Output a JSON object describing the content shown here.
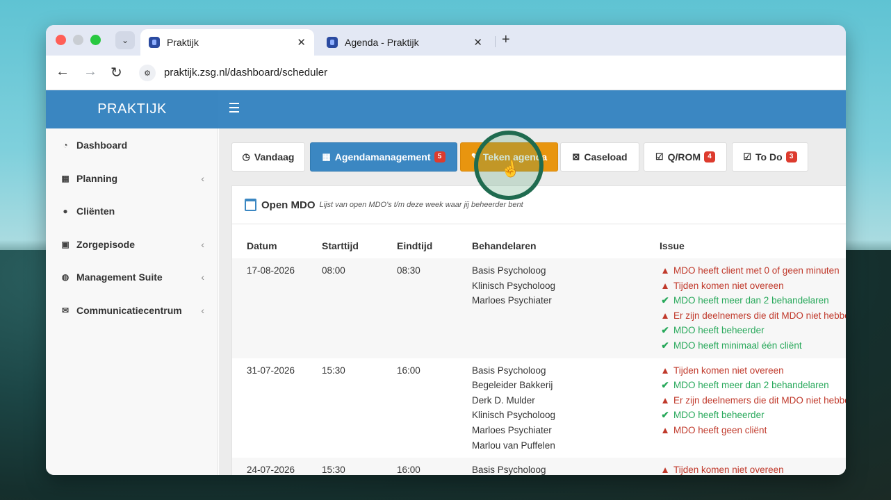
{
  "browser": {
    "tabs": [
      {
        "title": "Praktijk",
        "close": "✕"
      },
      {
        "title": "Agenda - Praktijk",
        "close": "✕"
      }
    ],
    "new_tab": "+",
    "url": "praktijk.zsg.nl/dashboard/scheduler",
    "back": "←",
    "forward": "→",
    "reload": "↻"
  },
  "app": {
    "brand": "PRAKTIJK"
  },
  "sidebar": {
    "items": [
      {
        "label": "Dashboard",
        "icon": "dashboard-icon",
        "glyph": "◔"
      },
      {
        "label": "Planning",
        "icon": "calendar-icon",
        "glyph": "▦",
        "chevron": "‹"
      },
      {
        "label": "Cliënten",
        "icon": "user-icon",
        "glyph": "●"
      },
      {
        "label": "Zorgepisode",
        "icon": "medkit-icon",
        "glyph": "▣",
        "chevron": "‹"
      },
      {
        "label": "Management Suite",
        "icon": "globe-icon",
        "glyph": "◍",
        "chevron": "‹"
      },
      {
        "label": "Communicatiecentrum",
        "icon": "envelope-icon",
        "glyph": "✉",
        "chevron": "‹"
      }
    ]
  },
  "toolbar": {
    "buttons": [
      {
        "label": "Vandaag",
        "icon": "clock-icon",
        "glyph": "◷"
      },
      {
        "label": "Agendamanagement",
        "icon": "calendar-icon",
        "glyph": "▦",
        "badge": "5"
      },
      {
        "label": "Teken agenda",
        "icon": "pencil-icon",
        "glyph": "✎"
      },
      {
        "label": "Caseload",
        "icon": "caseload-icon",
        "glyph": "⊠"
      },
      {
        "label": "Q/ROM",
        "icon": "checkbox-icon",
        "glyph": "☑",
        "badge": "4"
      },
      {
        "label": "To Do",
        "icon": "checkbox-icon",
        "glyph": "☑",
        "badge": "3"
      }
    ]
  },
  "panel": {
    "title": "Open MDO",
    "subtitle": "Lijst van open MDO's t/m deze week waar jij beheerder bent",
    "columns": [
      "Datum",
      "Starttijd",
      "Eindtijd",
      "Behandelaren",
      "Issue"
    ],
    "rows": [
      {
        "date": "17-08-2026",
        "start": "08:00",
        "end": "08:30",
        "behandelaren": [
          "Basis Psycholoog",
          "Klinisch Psycholoog",
          "Marloes Psychiater"
        ],
        "issues": [
          {
            "text": "MDO heeft client met 0 of geen minuten",
            "status": "bad"
          },
          {
            "text": "Tijden komen niet overeen",
            "status": "bad"
          },
          {
            "text": "MDO heeft meer dan 2 behandelaren",
            "status": "good"
          },
          {
            "text": "Er zijn deelnemers die dit MDO niet hebben",
            "status": "bad"
          },
          {
            "text": "MDO heeft beheerder",
            "status": "good"
          },
          {
            "text": "MDO heeft minimaal één cliënt",
            "status": "good"
          }
        ]
      },
      {
        "date": "31-07-2026",
        "start": "15:30",
        "end": "16:00",
        "behandelaren": [
          "Basis Psycholoog",
          "Begeleider Bakkerij",
          "Derk D. Mulder",
          "Klinisch Psycholoog",
          "Marloes Psychiater",
          "Marlou van Puffelen"
        ],
        "issues": [
          {
            "text": "Tijden komen niet overeen",
            "status": "bad"
          },
          {
            "text": "MDO heeft meer dan 2 behandelaren",
            "status": "good"
          },
          {
            "text": "Er zijn deelnemers die dit MDO niet hebben",
            "status": "bad"
          },
          {
            "text": "MDO heeft beheerder",
            "status": "good"
          },
          {
            "text": "MDO heeft geen cliënt",
            "status": "bad"
          }
        ]
      },
      {
        "date": "24-07-2026",
        "start": "15:30",
        "end": "16:00",
        "behandelaren": [
          "Basis Psycholoog"
        ],
        "issues": [
          {
            "text": "Tijden komen niet overeen",
            "status": "bad"
          }
        ]
      }
    ]
  },
  "glyphs": {
    "bad": "▲",
    "good": "✔"
  },
  "colors": {
    "primary": "#3b87c2",
    "warning": "#e8950f",
    "danger": "#c0392b",
    "success": "#27a85a"
  }
}
